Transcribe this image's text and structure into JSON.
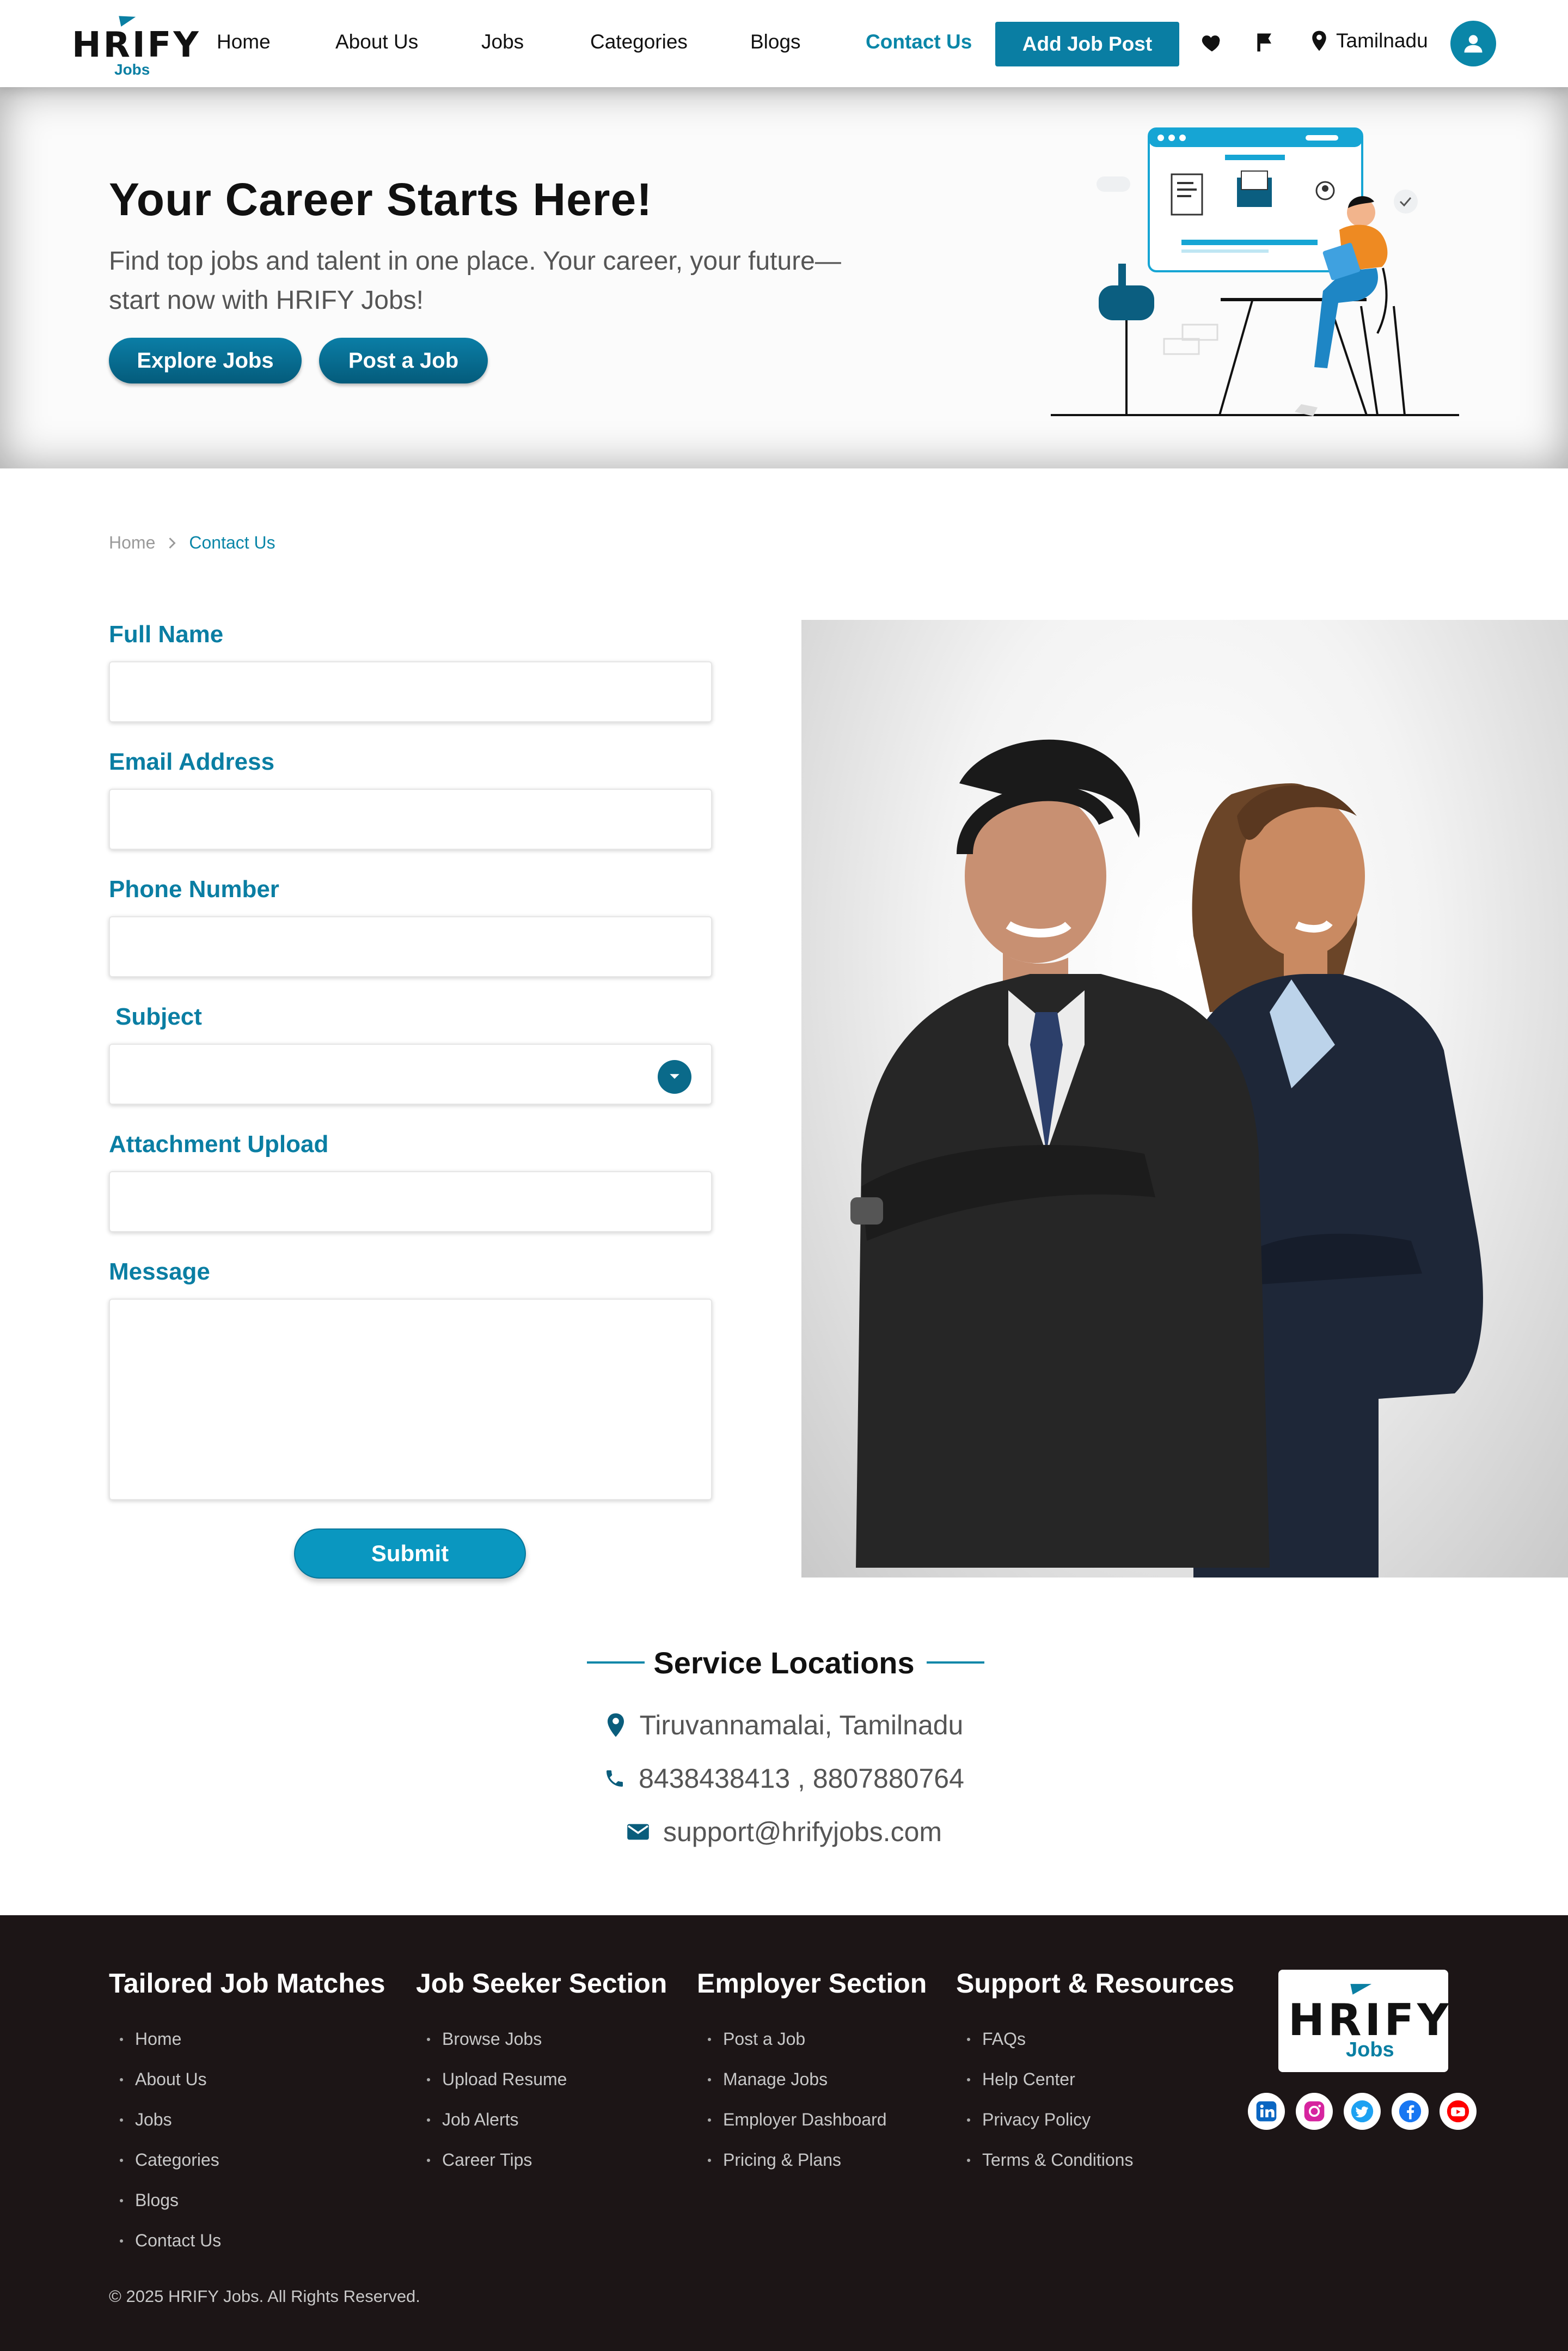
{
  "brand": {
    "word": "HRIFY",
    "sub": "Jobs"
  },
  "nav": {
    "links": [
      "Home",
      "About Us",
      "Jobs",
      "Categories",
      "Blogs",
      "Contact Us"
    ],
    "active": "Contact Us",
    "add_job_label": "Add Job Post",
    "location": "Tamilnadu",
    "icons": [
      "heart-icon",
      "flag-icon",
      "location-pin-icon",
      "user-icon"
    ]
  },
  "hero": {
    "title": "Your Career Starts Here!",
    "subtitle": "Find top jobs and talent in one place. Your career, your future—start now with HRIFY Jobs!",
    "btn_explore": "Explore Jobs",
    "btn_post": "Post a Job"
  },
  "breadcrumb": {
    "home": "Home",
    "current": "Contact Us"
  },
  "form": {
    "full_name_label": "Full Name",
    "full_name_value": "",
    "email_label": "Email Address",
    "email_value": "",
    "phone_label": "Phone Number",
    "phone_value": "",
    "subject_label": "Subject",
    "subject_value": "",
    "attachment_label": "Attachment Upload",
    "message_label": "Message",
    "message_value": "",
    "submit_label": "Submit"
  },
  "service": {
    "title": "Service Locations",
    "address": "Tiruvannamalai, Tamilnadu",
    "phone": "8438438413 , 8807880764",
    "email": "support@hrifyjobs.com"
  },
  "footer": {
    "col1": {
      "title": "Tailored Job Matches",
      "items": [
        "Home",
        "About Us",
        "Jobs",
        "Categories",
        "Blogs",
        "Contact Us"
      ]
    },
    "col2": {
      "title": "Job Seeker Section",
      "items": [
        "Browse Jobs",
        "Upload Resume",
        "Job Alerts",
        "Career Tips"
      ]
    },
    "col3": {
      "title": "Employer Section",
      "items": [
        "Post a Job",
        "Manage Jobs",
        "Employer Dashboard",
        "Pricing & Plans"
      ]
    },
    "col4": {
      "title": "Support & Resources",
      "items": [
        "FAQs",
        "Help Center",
        "Privacy Policy",
        "Terms & Conditions"
      ]
    },
    "socials": [
      "linkedin-icon",
      "instagram-icon",
      "twitter-icon",
      "facebook-icon",
      "youtube-icon"
    ],
    "copyright": "© 2025 HRIFY Jobs. All Rights Reserved."
  },
  "colors": {
    "accent": "#0a86a8",
    "accent_dark": "#045b7b",
    "footer_bg": "#1c1516"
  }
}
